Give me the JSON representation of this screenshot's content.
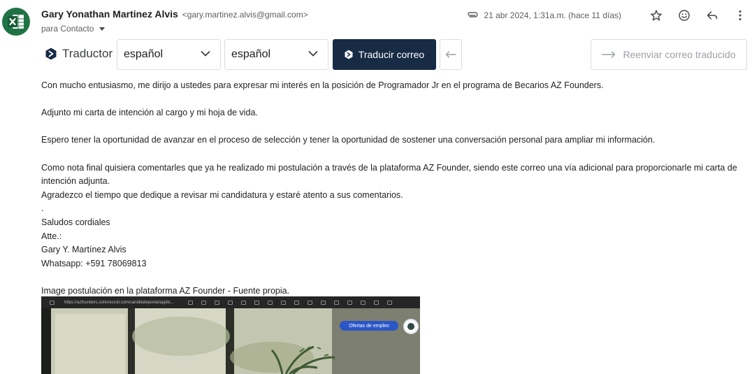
{
  "sender": {
    "name": "Gary Yonathan Martinez Alvis",
    "email": "<gary.martinez.alvis@gmail.com>",
    "to_label": "para Contacto",
    "avatar_icon": "excel-icon",
    "avatar_color": "#1f7244"
  },
  "meta": {
    "date": "21 abr 2024, 1:31a.m. (hace 11 días)",
    "icons": [
      "attachment-icon",
      "star-icon",
      "emoji-icon",
      "reply-icon",
      "more-vert-icon"
    ]
  },
  "translator": {
    "label": "Traductor",
    "source_lang": "español",
    "target_lang": "español",
    "translate_label": "Traducir correo",
    "forward_label": "Reenviar correo traducido",
    "button_color": "#172b45"
  },
  "body": {
    "lines": [
      "Con mucho entusiasmo, me dirijo a ustedes para expresar mi interés en la posición de Programador Jr en el programa de Becarios AZ Founders.",
      "",
      "Adjunto mi carta de intención al cargo y mi hoja de vida.",
      "",
      "Espero tener la oportunidad de avanzar en el proceso de selección y tener la oportunidad de sostener una conversación personal para ampliar mi información.",
      "",
      "Como nota final quisiera comentarles que ya he realizado mi postulación a través de la plataforma AZ Founder, siendo este correo una vía adicional para proporcionarle mi carta de intención adjunta.",
      "Agradezco el tiempo que dedique a revisar mi candidatura y estaré atento a sus comentarios.",
      ".",
      "Saludos cordiales",
      "Atte.:",
      "Gary Y. Martínez Alvis",
      "Whatsapp: +591 78069813",
      "",
      "Image postulación en la plataforma AZ Founder - Fuente propia."
    ]
  },
  "embedded_image": {
    "url_text": "https://azfounders.zohorecruit.com/candidateportal/applic...",
    "button_label": "Ofertas de empleo"
  }
}
